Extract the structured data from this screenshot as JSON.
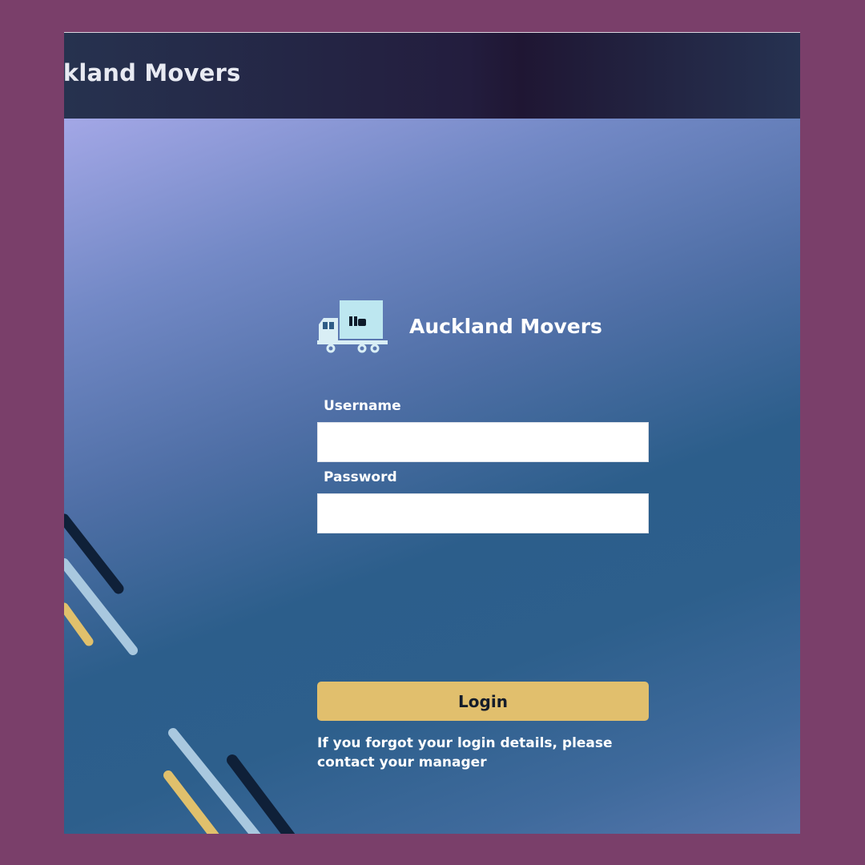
{
  "header": {
    "title": "Auckland Movers"
  },
  "brand": {
    "name": "Auckland Movers",
    "logo_icon": "moving-truck-icon"
  },
  "form": {
    "username_label": "Username",
    "username_value": "",
    "password_label": "Password",
    "password_value": "",
    "login_label": "Login",
    "help_text": "If you forgot your login details, please contact your manager"
  },
  "colors": {
    "outer_background": "#7a3f6a",
    "header_background": "#231d3e",
    "login_button": "#e1bf6d",
    "stripe_dark": "#0f2038",
    "stripe_light": "#a9c8df",
    "stripe_gold": "#e0c06c"
  }
}
